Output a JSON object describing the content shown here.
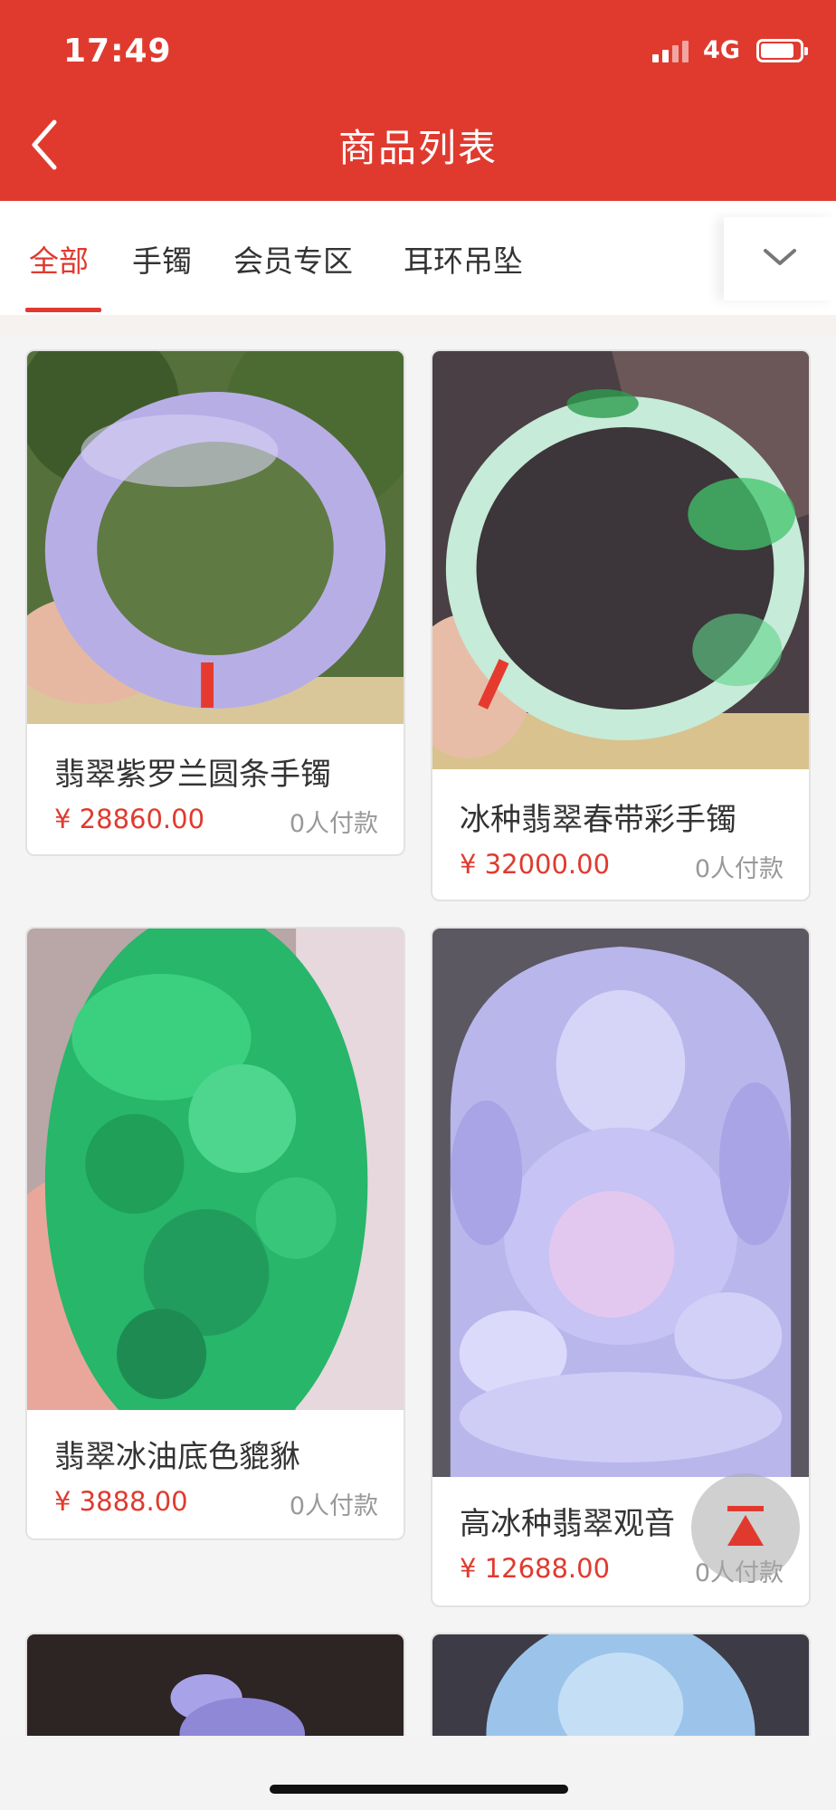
{
  "status_bar": {
    "time": "17:49",
    "network": "4G",
    "battery_level": 0.85
  },
  "header": {
    "title": "商品列表",
    "back_icon": "chevron-left-icon"
  },
  "tabs": [
    {
      "label": "全部",
      "active": true
    },
    {
      "label": "手镯",
      "active": false
    },
    {
      "label": "会员专区",
      "active": false
    },
    {
      "label": "耳环吊坠",
      "active": false
    }
  ],
  "tab_expand_icon": "chevron-down-icon",
  "colors": {
    "brand_red": "#e03a2f",
    "price_red": "#e03a2f",
    "muted_text": "#999999"
  },
  "products": [
    {
      "name": "翡翠紫罗兰圆条手镯",
      "price": "¥ 28860.00",
      "sales": "0人付款"
    },
    {
      "name": "冰种翡翠春带彩手镯",
      "price": "¥ 32000.00",
      "sales": "0人付款"
    },
    {
      "name": "翡翠冰油底色貔貅",
      "price": "¥ 3888.00",
      "sales": "0人付款"
    },
    {
      "name": "高冰种翡翠观音",
      "price": "¥ 12688.00",
      "sales": "0人付款"
    }
  ],
  "floating": {
    "back_to_top_icon": "arrow-to-top-icon"
  }
}
